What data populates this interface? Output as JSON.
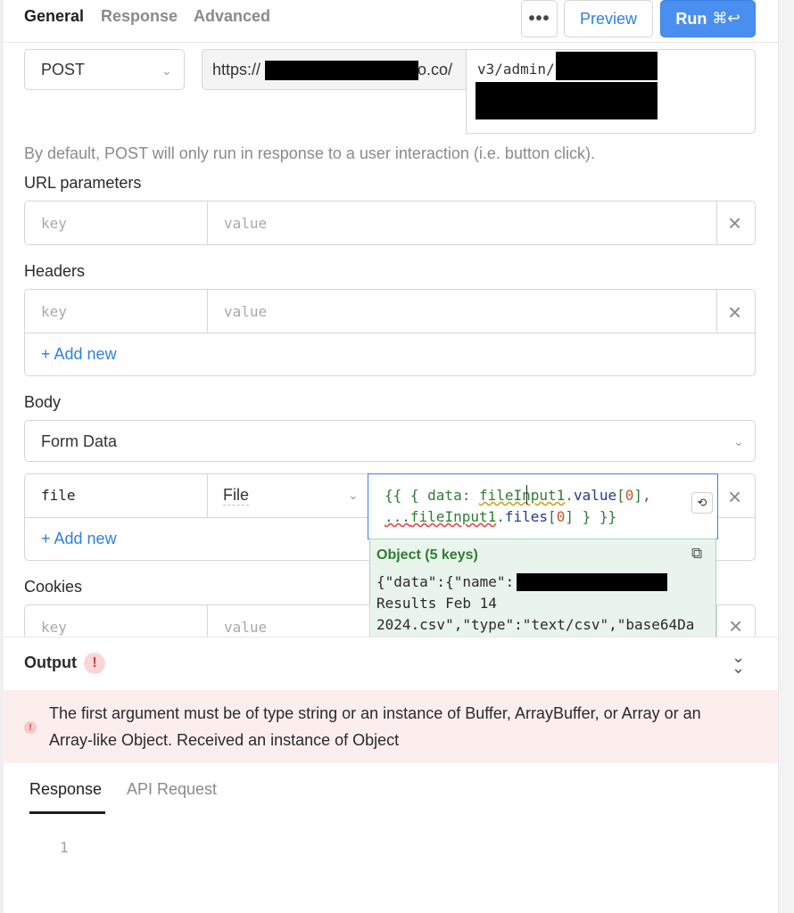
{
  "tabs": [
    {
      "label": "General"
    },
    {
      "label": "Response"
    },
    {
      "label": "Advanced"
    }
  ],
  "toolbar": {
    "more_label": "•••",
    "preview_label": "Preview",
    "run_label": "Run",
    "run_shortcut": "⌘↩"
  },
  "request": {
    "method": "POST",
    "url_prefix": "https://",
    "url_domain_suffix": "o.co/",
    "path": "v3/admin/"
  },
  "helper_text": "By default, POST will only run in response to a user interaction (i.e. button click).",
  "url_params": {
    "label": "URL parameters",
    "key_placeholder": "key",
    "value_placeholder": "value"
  },
  "headers": {
    "label": "Headers",
    "key_placeholder": "key",
    "value_placeholder": "value",
    "add_new": "+ Add new"
  },
  "body": {
    "label": "Body",
    "type": "Form Data",
    "row": {
      "key": "file",
      "type": "File"
    },
    "code": {
      "open": "{{ { data: ",
      "ident1": "fileInput1",
      "dot1": ".",
      "prop1": "value",
      "br1": "[",
      "num1": "0",
      "br1c": "],",
      "spread": "...",
      "ident2": "fileInput1",
      "dot2": ".",
      "prop2": "files",
      "br2": "[",
      "num2": "0",
      "close": "] } }}"
    },
    "add_new": "+ Add new"
  },
  "preview": {
    "title": "Object (5 keys)",
    "line1": "{\"data\":{\"name\":",
    "line2": "Results Feb 14",
    "line3": "2024.csv\",\"type\":\"text/csv\",\"base64Da"
  },
  "cookies": {
    "label": "Cookies",
    "key_placeholder": "key",
    "value_placeholder": "value"
  },
  "output": {
    "label": "Output",
    "badge": "!",
    "error_icon": "!",
    "error_line1": "The first argument must be of type string or an instance of Buffer, ArrayBuffer, or Array or an",
    "error_line2": "Array-like Object. Received an instance of Object"
  },
  "result_tabs": [
    {
      "label": "Response"
    },
    {
      "label": "API Request"
    }
  ],
  "editor": {
    "line_number": "1"
  },
  "icons": {
    "more": "ellipsis-icon",
    "chevron": "chevron-down-icon",
    "close": "close-icon",
    "copy": "copy-icon",
    "collapse": "double-chevron-icon",
    "refresh": "refresh-icon"
  },
  "colors": {
    "accent": "#2f7fe0",
    "run_button": "#4a8ff0",
    "error_bg": "#fdeeee",
    "code_green": "#2e7d32",
    "preview_bg": "#e9f5ec"
  }
}
